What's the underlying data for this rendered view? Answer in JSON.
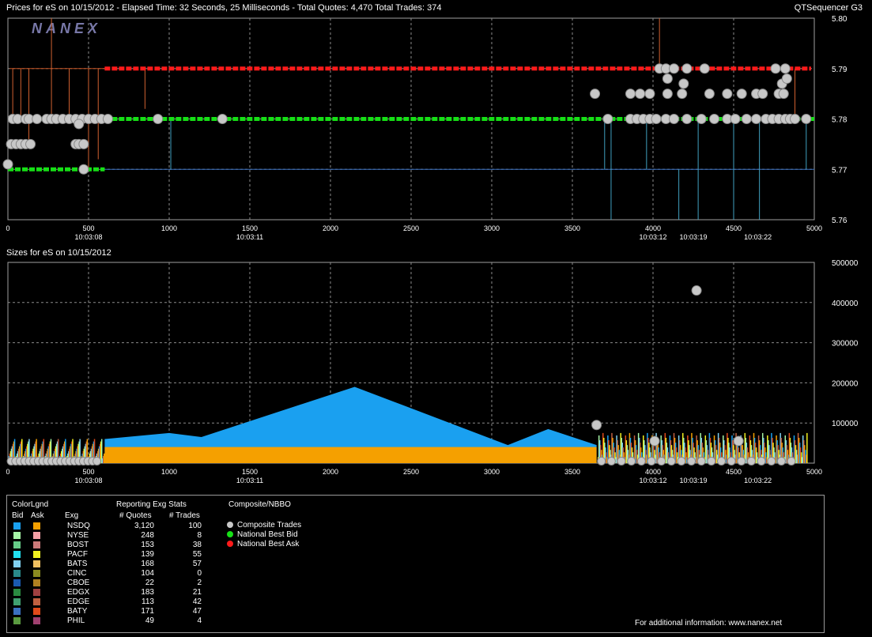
{
  "header": {
    "prices_title": "Prices for  eS  on  10/15/2012  -  Elapsed Time: 32 Seconds, 25 Milliseconds  -  Total Quotes: 4,470  Total Trades: 374",
    "brand": "QTSequencer G3",
    "sizes_title": "Sizes for  eS  on  10/15/2012",
    "watermark": "NANEX"
  },
  "chart_data": [
    {
      "type": "line",
      "name": "prices",
      "ylim": [
        5.76,
        5.8
      ],
      "xlim": [
        0,
        5000
      ],
      "y_ticks": [
        "5.80",
        "5.79",
        "5.78",
        "5.77",
        "5.76"
      ],
      "x_ticks": [
        "0",
        "500",
        "1000",
        "1500",
        "2000",
        "2500",
        "3000",
        "3500",
        "4000",
        "4500",
        "5000"
      ],
      "time_labels": [
        {
          "x": 500,
          "label": "10:03:08"
        },
        {
          "x": 1500,
          "label": "10:03:11"
        },
        {
          "x": 4000,
          "label": "10:03:12"
        },
        {
          "x": 4250,
          "label": "10:03:19"
        },
        {
          "x": 4650,
          "label": "10:03:22"
        }
      ],
      "grid": true,
      "series": [
        {
          "name": "National Best Ask",
          "color": "#ff1a1a",
          "segments": [
            [
              600,
              4980,
              5.79
            ]
          ]
        },
        {
          "name": "National Best Bid",
          "color": "#16e016",
          "segments": [
            [
              0,
              600,
              5.77
            ],
            [
              0,
              600,
              5.78
            ],
            [
              600,
              5000,
              5.78
            ]
          ]
        }
      ],
      "trades": [
        [
          30,
          5.78
        ],
        [
          60,
          5.78
        ],
        [
          110,
          5.78
        ],
        [
          130,
          5.78
        ],
        [
          180,
          5.78
        ],
        [
          240,
          5.78
        ],
        [
          270,
          5.78
        ],
        [
          300,
          5.78
        ],
        [
          340,
          5.78
        ],
        [
          380,
          5.78
        ],
        [
          420,
          5.78
        ],
        [
          460,
          5.78
        ],
        [
          500,
          5.78
        ],
        [
          540,
          5.78
        ],
        [
          580,
          5.78
        ],
        [
          620,
          5.78
        ],
        [
          930,
          5.78
        ],
        [
          1330,
          5.78
        ],
        [
          20,
          5.775
        ],
        [
          50,
          5.775
        ],
        [
          80,
          5.775
        ],
        [
          110,
          5.775
        ],
        [
          140,
          5.775
        ],
        [
          420,
          5.775
        ],
        [
          440,
          5.775
        ],
        [
          470,
          5.775
        ],
        [
          0,
          5.771
        ],
        [
          470,
          5.77
        ],
        [
          440,
          5.779
        ],
        [
          3640,
          5.785
        ],
        [
          3860,
          5.785
        ],
        [
          3920,
          5.785
        ],
        [
          3980,
          5.785
        ],
        [
          4090,
          5.785
        ],
        [
          4180,
          5.785
        ],
        [
          4350,
          5.785
        ],
        [
          4460,
          5.785
        ],
        [
          4550,
          5.785
        ],
        [
          4640,
          5.785
        ],
        [
          4680,
          5.785
        ],
        [
          4780,
          5.785
        ],
        [
          4810,
          5.785
        ],
        [
          4040,
          5.79
        ],
        [
          4080,
          5.79
        ],
        [
          4130,
          5.79
        ],
        [
          4210,
          5.79
        ],
        [
          4320,
          5.79
        ],
        [
          4760,
          5.79
        ],
        [
          4820,
          5.79
        ],
        [
          4090,
          5.788
        ],
        [
          4190,
          5.787
        ],
        [
          4800,
          5.787
        ],
        [
          4830,
          5.788
        ],
        [
          3720,
          5.78
        ],
        [
          3860,
          5.78
        ],
        [
          3900,
          5.78
        ],
        [
          3940,
          5.78
        ],
        [
          3980,
          5.78
        ],
        [
          4020,
          5.78
        ],
        [
          4080,
          5.78
        ],
        [
          4130,
          5.78
        ],
        [
          4210,
          5.78
        ],
        [
          4300,
          5.78
        ],
        [
          4380,
          5.78
        ],
        [
          4460,
          5.78
        ],
        [
          4510,
          5.78
        ],
        [
          4580,
          5.78
        ],
        [
          4640,
          5.78
        ],
        [
          4700,
          5.78
        ],
        [
          4740,
          5.78
        ],
        [
          4780,
          5.78
        ],
        [
          4820,
          5.78
        ],
        [
          4850,
          5.78
        ],
        [
          4880,
          5.78
        ],
        [
          4950,
          5.78
        ]
      ]
    },
    {
      "type": "area",
      "name": "sizes",
      "ylim": [
        0,
        500000
      ],
      "xlim": [
        0,
        5000
      ],
      "y_ticks": [
        "500000",
        "400000",
        "300000",
        "200000",
        "100000"
      ],
      "x_ticks": [
        "0",
        "500",
        "1000",
        "1500",
        "2000",
        "2500",
        "3000",
        "3500",
        "4000",
        "4500",
        "5000"
      ],
      "time_labels": [
        {
          "x": 500,
          "label": "10:03:08"
        },
        {
          "x": 1500,
          "label": "10:03:11"
        },
        {
          "x": 4000,
          "label": "10:03:12"
        },
        {
          "x": 4250,
          "label": "10:03:19"
        },
        {
          "x": 4650,
          "label": "10:03:22"
        }
      ],
      "grid": true,
      "series": [
        {
          "name": "NSDQ Bid size",
          "color": "#1aa0f0",
          "x": [
            600,
            1000,
            1200,
            2150,
            3100,
            3350,
            3650
          ],
          "values": [
            60000,
            75000,
            65000,
            190000,
            45000,
            85000,
            45000
          ]
        },
        {
          "name": "NSDQ Ask size",
          "color": "#f5a000",
          "x": [
            600,
            3650
          ],
          "values": [
            40000,
            40000
          ]
        }
      ],
      "trades": [
        [
          3650,
          95000
        ],
        [
          4010,
          55000
        ],
        [
          4530,
          55000
        ],
        [
          4270,
          430000
        ]
      ]
    }
  ],
  "legend": {
    "heading_color": "ColorLgnd",
    "heading_bid": "Bid",
    "heading_ask": "Ask",
    "heading_exg": "Exg",
    "heading_stats": "Reporting Exg Stats",
    "heading_quotes": "# Quotes",
    "heading_trades": "# Trades",
    "heading_composite": "Composite/NBBO",
    "rows": [
      {
        "exg": "NSDQ",
        "quotes": "3,120",
        "trades": "100",
        "bid": "#1aa0f0",
        "ask": "#f5a000"
      },
      {
        "exg": "NYSE",
        "quotes": "248",
        "trades": "8",
        "bid": "#a6f5a6",
        "ask": "#f5a0a6"
      },
      {
        "exg": "BOST",
        "quotes": "153",
        "trades": "38",
        "bid": "#66cc88",
        "ask": "#cc7a7a"
      },
      {
        "exg": "PACF",
        "quotes": "139",
        "trades": "55",
        "bid": "#22e0f0",
        "ask": "#f0f020"
      },
      {
        "exg": "BATS",
        "quotes": "168",
        "trades": "57",
        "bid": "#80d0f0",
        "ask": "#f0c060"
      },
      {
        "exg": "CINC",
        "quotes": "104",
        "trades": "0",
        "bid": "#2a8a8a",
        "ask": "#8a8a20"
      },
      {
        "exg": "CBOE",
        "quotes": "22",
        "trades": "2",
        "bid": "#1a5ab0",
        "ask": "#b08020"
      },
      {
        "exg": "EDGX",
        "quotes": "183",
        "trades": "21",
        "bid": "#2a8a40",
        "ask": "#a04040"
      },
      {
        "exg": "EDGE",
        "quotes": "113",
        "trades": "42",
        "bid": "#40a070",
        "ask": "#c06040"
      },
      {
        "exg": "BATY",
        "quotes": "171",
        "trades": "47",
        "bid": "#3a70c0",
        "ask": "#e04a1a"
      },
      {
        "exg": "PHIL",
        "quotes": "49",
        "trades": "4",
        "bid": "#5a9a40",
        "ask": "#a04070"
      }
    ],
    "composite_items": [
      {
        "label": "Composite Trades",
        "color": "#c8c8c8"
      },
      {
        "label": "National Best Bid",
        "color": "#16e016"
      },
      {
        "label": "National Best Ask",
        "color": "#ff1a1a"
      }
    ],
    "footer": "For additional information: www.nanex.net"
  }
}
